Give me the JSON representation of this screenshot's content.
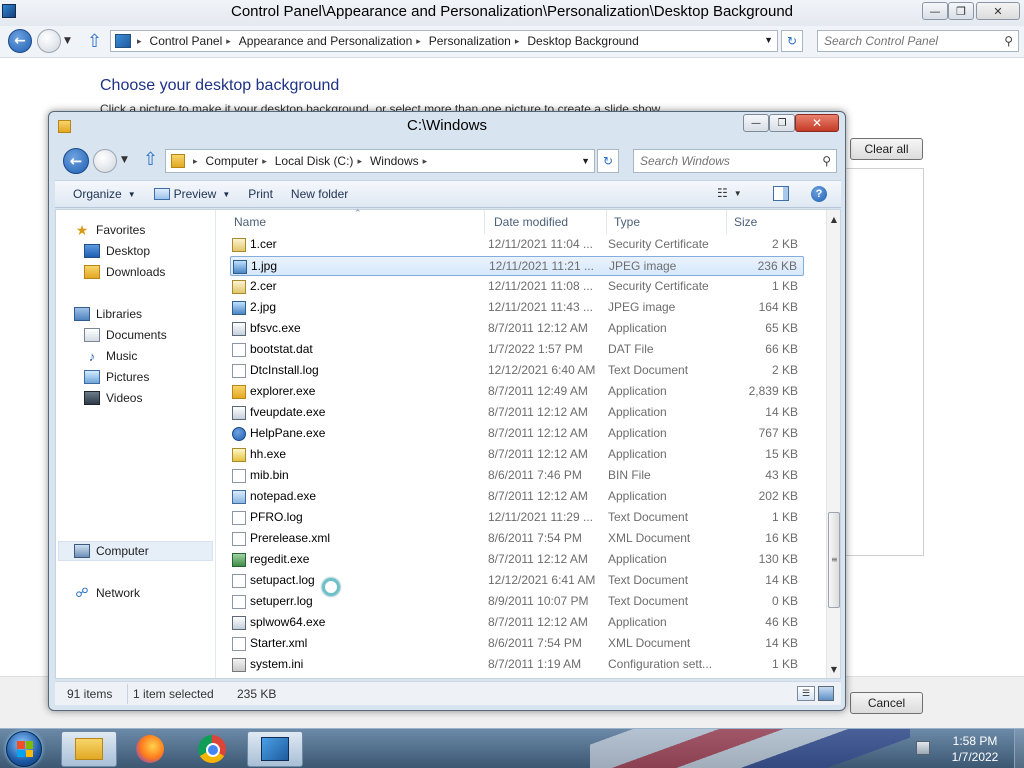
{
  "control_panel": {
    "title": "Control Panel\\Appearance and Personalization\\Personalization\\Desktop Background",
    "caption_buttons": {
      "minimize": "—",
      "maximize": "❐",
      "close": "✕"
    },
    "breadcrumbs": [
      "Control Panel",
      "Appearance and Personalization",
      "Personalization",
      "Desktop Background"
    ],
    "search_placeholder": "Search Control Panel",
    "heading": "Choose your desktop background",
    "subheading": "Click a picture to make it your desktop background, or select more than one picture to create a slide show.",
    "clear_all_label": "Clear all",
    "cancel_label": "Cancel"
  },
  "dialog": {
    "title": "C:\\Windows",
    "caption_buttons": {
      "minimize": "—",
      "maximize": "❐",
      "close": "✕"
    },
    "breadcrumbs": [
      "Computer",
      "Local Disk (C:)",
      "Windows"
    ],
    "search_placeholder": "Search Windows",
    "toolbar": {
      "organize": "Organize",
      "preview": "Preview",
      "print": "Print",
      "new_folder": "New folder"
    },
    "nav": {
      "favorites": "Favorites",
      "desktop": "Desktop",
      "downloads": "Downloads",
      "libraries": "Libraries",
      "documents": "Documents",
      "music": "Music",
      "pictures": "Pictures",
      "videos": "Videos",
      "computer": "Computer",
      "network": "Network"
    },
    "columns": {
      "name": "Name",
      "date": "Date modified",
      "type": "Type",
      "size": "Size"
    },
    "files": [
      {
        "name": "1.cer",
        "date": "12/11/2021 11:04 ...",
        "type": "Security Certificate",
        "size": "2 KB",
        "icon": "certificate-icon"
      },
      {
        "name": "1.jpg",
        "date": "12/11/2021 11:21 ...",
        "type": "JPEG image",
        "size": "236 KB",
        "icon": "image-icon",
        "selected": true
      },
      {
        "name": "2.cer",
        "date": "12/11/2021 11:08 ...",
        "type": "Security Certificate",
        "size": "1 KB",
        "icon": "certificate-icon"
      },
      {
        "name": "2.jpg",
        "date": "12/11/2021 11:43 ...",
        "type": "JPEG image",
        "size": "164 KB",
        "icon": "image-icon"
      },
      {
        "name": "bfsvc.exe",
        "date": "8/7/2011 12:12 AM",
        "type": "Application",
        "size": "65 KB",
        "icon": "application-icon"
      },
      {
        "name": "bootstat.dat",
        "date": "1/7/2022 1:57 PM",
        "type": "DAT File",
        "size": "66 KB",
        "icon": "document-icon"
      },
      {
        "name": "DtcInstall.log",
        "date": "12/12/2021 6:40 AM",
        "type": "Text Document",
        "size": "2 KB",
        "icon": "text-document-icon"
      },
      {
        "name": "explorer.exe",
        "date": "8/7/2011 12:49 AM",
        "type": "Application",
        "size": "2,839 KB",
        "icon": "explorer-icon"
      },
      {
        "name": "fveupdate.exe",
        "date": "8/7/2011 12:12 AM",
        "type": "Application",
        "size": "14 KB",
        "icon": "application-icon"
      },
      {
        "name": "HelpPane.exe",
        "date": "8/7/2011 12:12 AM",
        "type": "Application",
        "size": "767 KB",
        "icon": "help-icon"
      },
      {
        "name": "hh.exe",
        "date": "8/7/2011 12:12 AM",
        "type": "Application",
        "size": "15 KB",
        "icon": "help-viewer-icon"
      },
      {
        "name": "mib.bin",
        "date": "8/6/2011 7:46 PM",
        "type": "BIN File",
        "size": "43 KB",
        "icon": "document-icon"
      },
      {
        "name": "notepad.exe",
        "date": "8/7/2011 12:12 AM",
        "type": "Application",
        "size": "202 KB",
        "icon": "notepad-icon"
      },
      {
        "name": "PFRO.log",
        "date": "12/11/2021 11:29 ...",
        "type": "Text Document",
        "size": "1 KB",
        "icon": "text-document-icon"
      },
      {
        "name": "Prerelease.xml",
        "date": "8/6/2011 7:54 PM",
        "type": "XML Document",
        "size": "16 KB",
        "icon": "xml-document-icon"
      },
      {
        "name": "regedit.exe",
        "date": "8/7/2011 12:12 AM",
        "type": "Application",
        "size": "130 KB",
        "icon": "regedit-icon"
      },
      {
        "name": "setupact.log",
        "date": "12/12/2021 6:41 AM",
        "type": "Text Document",
        "size": "14 KB",
        "icon": "text-document-icon"
      },
      {
        "name": "setuperr.log",
        "date": "8/9/2011 10:07 PM",
        "type": "Text Document",
        "size": "0 KB",
        "icon": "text-document-icon"
      },
      {
        "name": "splwow64.exe",
        "date": "8/7/2011 12:12 AM",
        "type": "Application",
        "size": "46 KB",
        "icon": "application-icon"
      },
      {
        "name": "Starter.xml",
        "date": "8/6/2011 7:54 PM",
        "type": "XML Document",
        "size": "14 KB",
        "icon": "xml-document-icon"
      },
      {
        "name": "system.ini",
        "date": "8/7/2011 1:19 AM",
        "type": "Configuration sett...",
        "size": "1 KB",
        "icon": "config-icon"
      }
    ],
    "status": {
      "item_count": "91 items",
      "selected": "1 item selected",
      "selected_size": "235 KB"
    }
  },
  "taskbar": {
    "time": "1:58 PM",
    "date": "1/7/2022",
    "apps": [
      "windows-explorer-icon",
      "firefox-icon",
      "chrome-icon",
      "control-panel-icon"
    ]
  }
}
